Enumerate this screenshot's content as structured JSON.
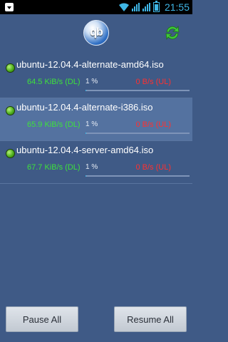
{
  "status_bar": {
    "time": "21:55"
  },
  "header": {
    "logo_text": "qb",
    "refresh_icon": "refresh-icon"
  },
  "torrents": [
    {
      "name": "ubuntu-12.04.4-alternate-amd64.iso",
      "dl_rate": "64.5 KiB/s (DL)",
      "progress_text": "1 %",
      "progress": 0.01,
      "ul_rate": "0 B/s (UL)",
      "status": "downloading"
    },
    {
      "name": "ubuntu-12.04.4-alternate-i386.iso",
      "dl_rate": "65.9 KiB/s (DL)",
      "progress_text": "1 %",
      "progress": 0.01,
      "ul_rate": "0 B/s (UL)",
      "status": "downloading"
    },
    {
      "name": "ubuntu-12.04.4-server-amd64.iso",
      "dl_rate": "67.7 KiB/s (DL)",
      "progress_text": "1 %",
      "progress": 0.01,
      "ul_rate": "0 B/s (UL)",
      "status": "downloading"
    }
  ],
  "actions": {
    "pause_all": "Pause All",
    "resume_all": "Resume All"
  },
  "colors": {
    "background": "#3f5a86",
    "selected_row": "#5472a0",
    "dl_text": "#3ee13c",
    "ul_text": "#ff3030",
    "accent": "#3fb6e6"
  }
}
